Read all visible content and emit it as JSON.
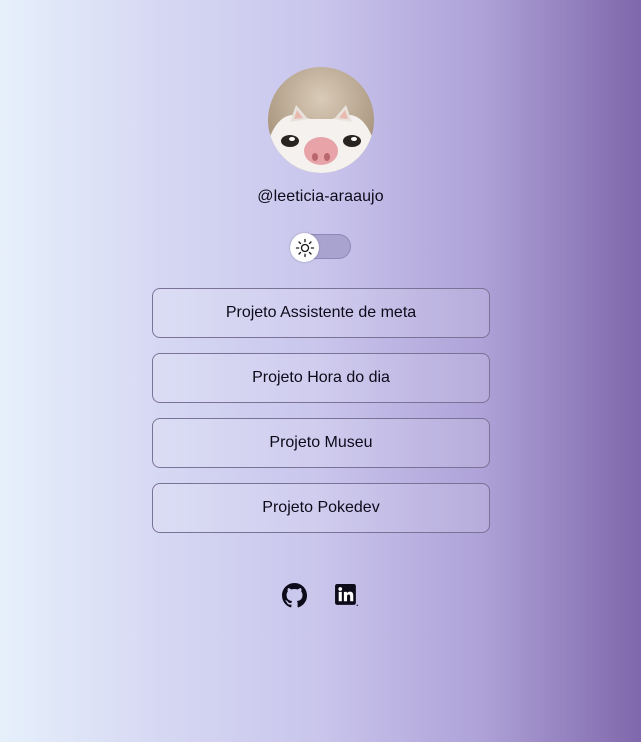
{
  "profile": {
    "username": "@leeticia-araaujo",
    "avatar_icon": "cat-face-photo"
  },
  "theme_toggle": {
    "icon": "sun-icon",
    "state": "light"
  },
  "links": [
    {
      "label": "Projeto Assistente de meta"
    },
    {
      "label": "Projeto Hora do dia"
    },
    {
      "label": "Projeto Museu"
    },
    {
      "label": "Projeto Pokedev"
    }
  ],
  "social": [
    {
      "icon": "github-icon"
    },
    {
      "icon": "linkedin-icon"
    }
  ],
  "colors": {
    "gradient_start": "#e6f0fb",
    "gradient_end": "#7f67ab",
    "text": "#0d0a1a",
    "button_border": "#7b7397"
  }
}
